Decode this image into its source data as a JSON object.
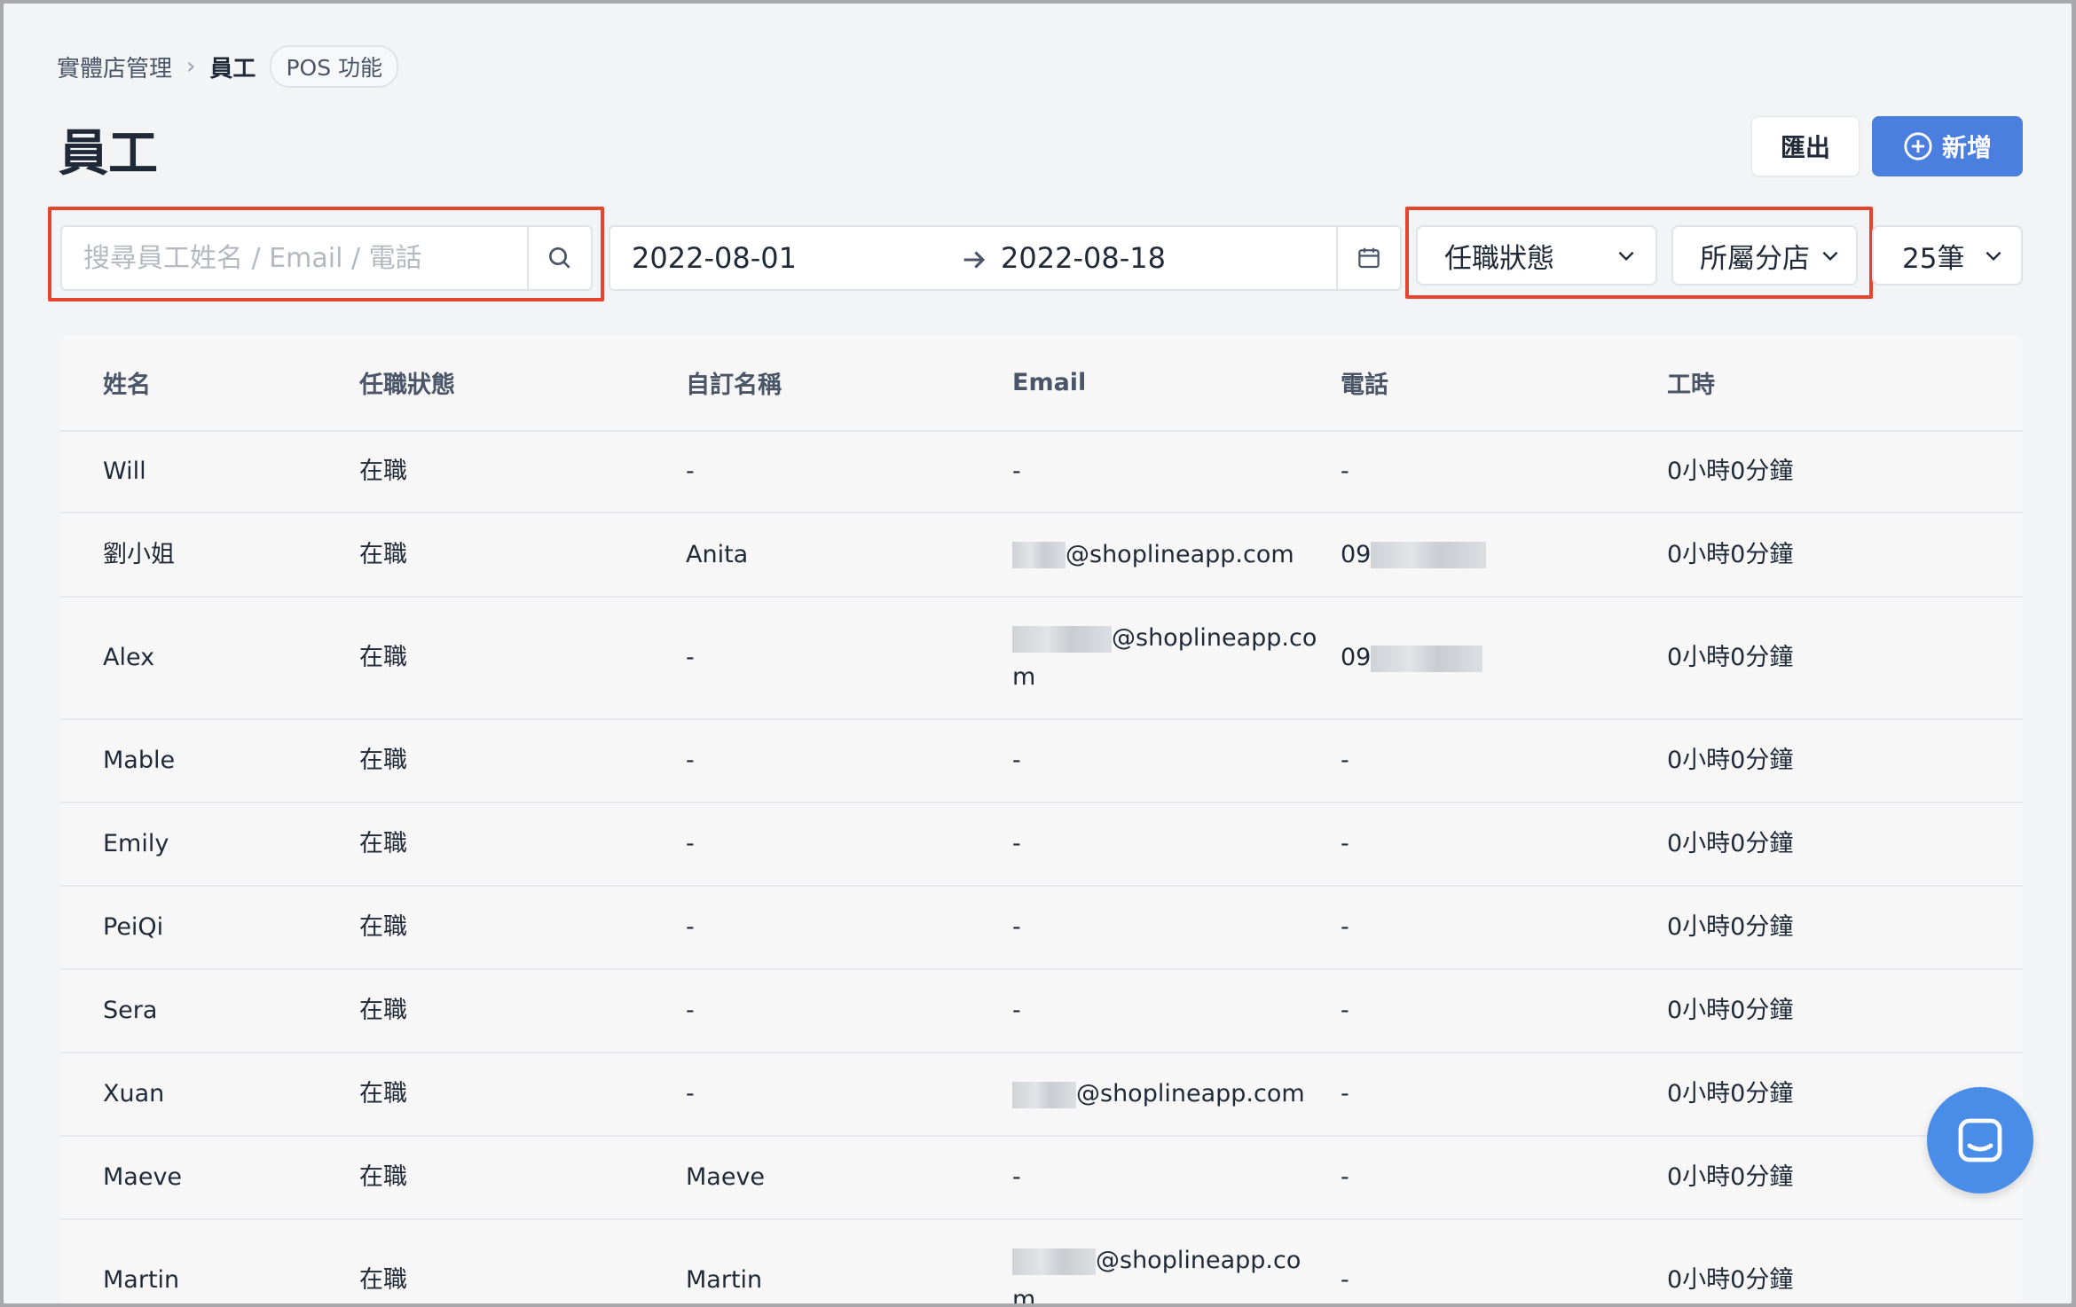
{
  "breadcrumb": {
    "parent": "實體店管理",
    "current": "員工",
    "tag": "POS 功能"
  },
  "title": "員工",
  "actions": {
    "export": "匯出",
    "add": "新增"
  },
  "filters": {
    "search_placeholder": "搜尋員工姓名 / Email / 電話",
    "date_start": "2022-08-01",
    "date_end": "2022-08-18",
    "status": "任職狀態",
    "branch": "所屬分店",
    "page_size": "25筆"
  },
  "table": {
    "headers": [
      "姓名",
      "任職狀態",
      "自訂名稱",
      "Email",
      "電話",
      "工時"
    ],
    "rows": [
      {
        "name": "Will",
        "status": "在職",
        "custom": "-",
        "email": "-",
        "phone": "-",
        "hours": "0小時0分鐘"
      },
      {
        "name": "劉小姐",
        "status": "在職",
        "custom": "Anita",
        "email": "@shoplineapp.com",
        "phone": "09",
        "hours": "0小時0分鐘"
      },
      {
        "name": "Alex",
        "status": "在職",
        "custom": "-",
        "email": "@shoplineapp.com",
        "phone": "09",
        "hours": "0小時0分鐘"
      },
      {
        "name": "Mable",
        "status": "在職",
        "custom": "-",
        "email": "-",
        "phone": "-",
        "hours": "0小時0分鐘"
      },
      {
        "name": "Emily",
        "status": "在職",
        "custom": "-",
        "email": "-",
        "phone": "-",
        "hours": "0小時0分鐘"
      },
      {
        "name": "PeiQi",
        "status": "在職",
        "custom": "-",
        "email": "-",
        "phone": "-",
        "hours": "0小時0分鐘"
      },
      {
        "name": "Sera",
        "status": "在職",
        "custom": "-",
        "email": "-",
        "phone": "-",
        "hours": "0小時0分鐘"
      },
      {
        "name": "Xuan",
        "status": "在職",
        "custom": "-",
        "email": "@shoplineapp.com",
        "phone": "-",
        "hours": "0小時0分鐘"
      },
      {
        "name": "Maeve",
        "status": "在職",
        "custom": "Maeve",
        "email": "-",
        "phone": "-",
        "hours": "0小時0分鐘"
      },
      {
        "name": "Martin",
        "status": "在職",
        "custom": "Martin",
        "email": "@shoplineapp.com",
        "phone": "-",
        "hours": "0小時0分鐘"
      }
    ]
  },
  "icons": {
    "search": "search-icon",
    "calendar": "calendar-icon",
    "arrow": "arrow-right-icon",
    "chevron": "chevron-down-icon",
    "add": "plus-circle-icon",
    "chat": "chat-icon"
  },
  "colors": {
    "primary": "#4a7fe0",
    "highlight": "#e5442f",
    "chat": "#4a8de8"
  }
}
